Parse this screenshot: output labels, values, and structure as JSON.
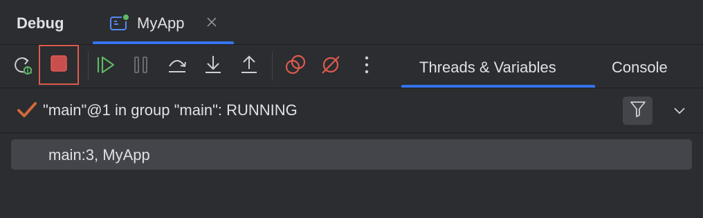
{
  "window": {
    "title": "Debug"
  },
  "session_tab": {
    "label": "MyApp",
    "icon": "app-window-icon",
    "close_icon": "close-icon"
  },
  "toolbar": {
    "buttons": [
      {
        "name": "rerun-debug",
        "icon": "rerun-bug-icon"
      },
      {
        "name": "stop",
        "icon": "stop-icon",
        "highlighted": true
      },
      {
        "name": "resume",
        "icon": "resume-icon"
      },
      {
        "name": "pause",
        "icon": "pause-icon"
      },
      {
        "name": "step-over",
        "icon": "step-over-icon"
      },
      {
        "name": "step-into",
        "icon": "step-into-icon"
      },
      {
        "name": "step-out",
        "icon": "step-out-icon"
      },
      {
        "name": "view-breakpoints",
        "icon": "view-breakpoints-icon"
      },
      {
        "name": "mute-breakpoints",
        "icon": "mute-breakpoints-icon"
      },
      {
        "name": "more",
        "icon": "more-vertical-icon"
      }
    ],
    "tabs": [
      {
        "label": "Threads & Variables",
        "active": true
      },
      {
        "label": "Console",
        "active": false
      }
    ]
  },
  "thread": {
    "status_icon": "check-icon",
    "label": "\"main\"@1 in group \"main\": RUNNING",
    "filter_icon": "filter-icon",
    "dropdown_icon": "chevron-down-icon"
  },
  "frames": [
    {
      "label": "main:3, MyApp"
    }
  ],
  "colors": {
    "background": "#2b2d30",
    "accent": "#3574f0",
    "stop_red": "#e05a4e",
    "resume_green": "#5fb865",
    "check_orange": "#d0693a"
  }
}
